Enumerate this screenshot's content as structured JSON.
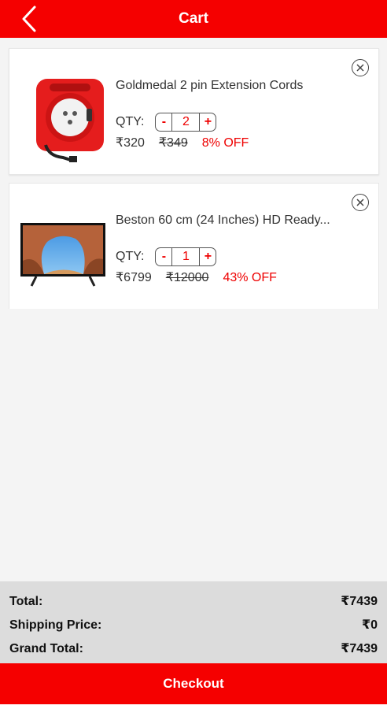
{
  "header": {
    "title": "Cart",
    "back_icon": "chevron-left-icon",
    "background": "#f50000"
  },
  "cart": {
    "items": [
      {
        "name": "Goldmedal 2 pin Extension Cords",
        "qty_label": "QTY:",
        "qty": "2",
        "decrement": "-",
        "increment": "+",
        "price": "₹320",
        "mrp": "₹349",
        "discount": "8% OFF",
        "image": "extension-cord-reel"
      },
      {
        "name": "Beston 60 cm (24 Inches) HD Ready...",
        "qty_label": "QTY:",
        "qty": "1",
        "decrement": "-",
        "increment": "+",
        "price": "₹6799",
        "mrp": "₹12000",
        "discount": "43% OFF",
        "image": "led-tv"
      }
    ]
  },
  "summary": {
    "total_label": "Total:",
    "total_value": "₹7439",
    "shipping_label": "Shipping Price:",
    "shipping_value": "₹0",
    "grand_total_label": "Grand Total:",
    "grand_total_value": "₹7439"
  },
  "checkout": {
    "label": "Checkout"
  },
  "colors": {
    "accent": "#f50000",
    "discount": "#e00000",
    "summary_bg": "#dcdcdc"
  }
}
